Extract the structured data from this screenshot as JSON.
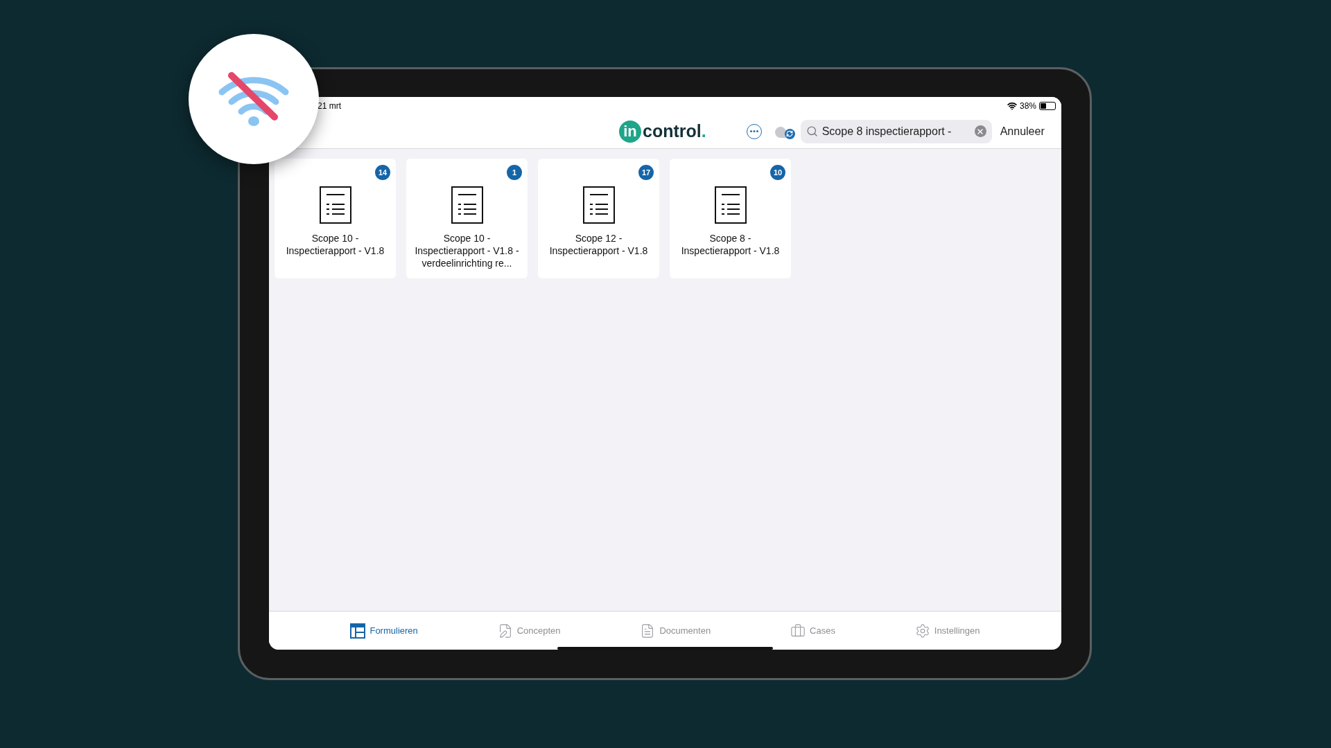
{
  "status_bar": {
    "date": "21 mrt",
    "battery": "38%"
  },
  "header": {
    "logo": {
      "mark": "in",
      "name": "control",
      "dot": "."
    },
    "search": {
      "value": "Scope 8 inspectierapport -"
    },
    "cancel": "Annuleer"
  },
  "forms": [
    {
      "title": "Scope 10 - Inspectierapport - V1.8",
      "count": "14"
    },
    {
      "title": "Scope 10 - Inspectierapport - V1.8 - verdeelinrichting re...",
      "count": "1"
    },
    {
      "title": "Scope 12 - Inspectierapport - V1.8",
      "count": "17"
    },
    {
      "title": "Scope 8 - Inspectierapport - V1.8",
      "count": "10"
    }
  ],
  "tab_bar": [
    {
      "kind": "forms",
      "label": "Formulieren",
      "selected": true
    },
    {
      "kind": "drafts",
      "label": "Concepten",
      "selected": false
    },
    {
      "kind": "documents",
      "label": "Documenten",
      "selected": false
    },
    {
      "kind": "cases",
      "label": "Cases",
      "selected": false
    },
    {
      "kind": "settings",
      "label": "Instellingen",
      "selected": false
    }
  ]
}
